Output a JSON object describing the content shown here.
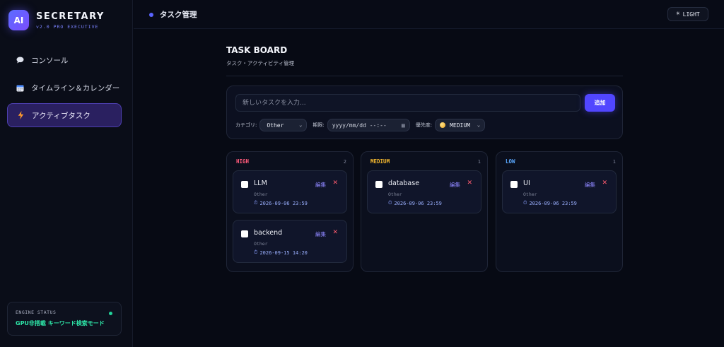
{
  "brand": {
    "logo": "AI",
    "name": "SECRETARY",
    "subtitle": "v2.0 PRO EXECUTIVE"
  },
  "sidebar": {
    "items": [
      {
        "label": "コンソール",
        "icon": "chat-bubble-icon",
        "active": false
      },
      {
        "label": "タイムライン＆カレンダー",
        "icon": "calendar-icon",
        "active": false
      },
      {
        "label": "アクティブタスク",
        "icon": "lightning-icon",
        "active": true
      }
    ]
  },
  "engine": {
    "label": "ENGINE STATUS",
    "value": "GPU非搭載 キーワード検索モード",
    "status_color": "#22d39a"
  },
  "header": {
    "title": "タスク管理",
    "theme_button": "LIGHT",
    "theme_icon": "sun-icon"
  },
  "board": {
    "title": "TASK BOARD",
    "subtitle": "タスク・アクティビティ管理"
  },
  "composer": {
    "input_placeholder": "新しいタスクを入力...",
    "input_value": "",
    "add_label": "追加",
    "category_label": "カテゴリ:",
    "category_value": "Other",
    "deadline_label": "期限:",
    "deadline_placeholder": "yyyy/mm/dd --:--",
    "priority_label": "優先度:",
    "priority_value": "MEDIUM"
  },
  "columns": [
    {
      "name": "HIGH",
      "count": "2",
      "color": "#ff5a7a",
      "cards": [
        {
          "title": "LLM",
          "category": "Other",
          "due": "2026-09-06 23:59",
          "edit": "編集",
          "done": false
        },
        {
          "title": "backend",
          "category": "Other",
          "due": "2026-09-15 14:20",
          "edit": "編集",
          "done": false
        }
      ]
    },
    {
      "name": "MEDIUM",
      "count": "1",
      "color": "#f5b82e",
      "cards": [
        {
          "title": "database",
          "category": "Other",
          "due": "2026-09-06 23:59",
          "edit": "編集",
          "done": false
        }
      ]
    },
    {
      "name": "LOW",
      "count": "1",
      "color": "#5aa8ff",
      "cards": [
        {
          "title": "UI",
          "category": "Other",
          "due": "2026-09-06 23:59",
          "edit": "編集",
          "done": false
        }
      ]
    }
  ],
  "colors": {
    "accent": "#5146ff",
    "background": "#070a14",
    "danger": "#ff5a6e"
  }
}
